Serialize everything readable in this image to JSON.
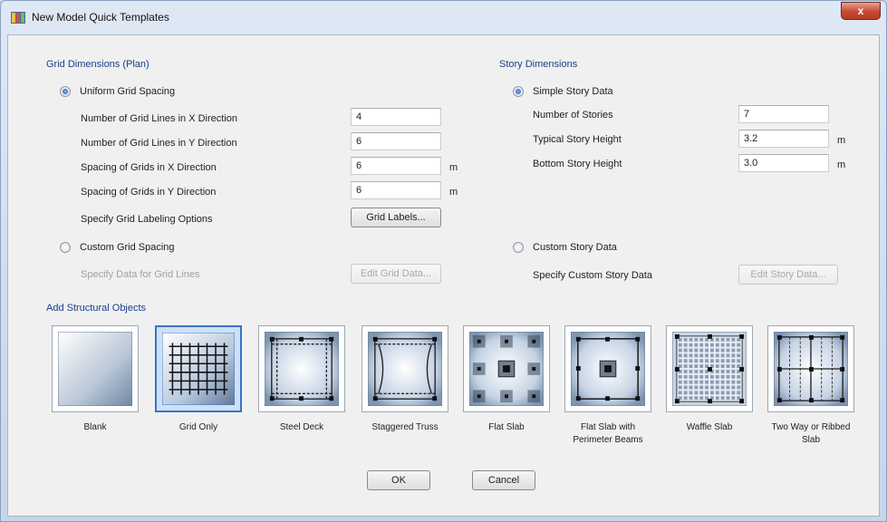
{
  "window": {
    "title": "New Model Quick Templates",
    "close_glyph": "x"
  },
  "grid": {
    "group_title": "Grid Dimensions (Plan)",
    "uniform_label": "Uniform Grid Spacing",
    "uniform_selected": true,
    "fields": [
      {
        "label": "Number of Grid Lines in X Direction",
        "value": "4",
        "unit": ""
      },
      {
        "label": "Number of Grid Lines in Y Direction",
        "value": "6",
        "unit": ""
      },
      {
        "label": "Spacing of Grids in X Direction",
        "value": "6",
        "unit": "m"
      },
      {
        "label": "Spacing of Grids in Y Direction",
        "value": "6",
        "unit": "m"
      }
    ],
    "labeling_label": "Specify Grid Labeling Options",
    "labeling_button": "Grid Labels...",
    "custom_label": "Custom Grid Spacing",
    "custom_data_label": "Specify Data for Grid Lines",
    "custom_button": "Edit Grid Data..."
  },
  "story": {
    "group_title": "Story Dimensions",
    "simple_label": "Simple Story Data",
    "simple_selected": true,
    "fields": [
      {
        "label": "Number of Stories",
        "value": "7",
        "unit": ""
      },
      {
        "label": "Typical Story Height",
        "value": "3.2",
        "unit": "m"
      },
      {
        "label": "Bottom Story Height",
        "value": "3.0",
        "unit": "m"
      }
    ],
    "custom_label": "Custom Story Data",
    "custom_data_label": "Specify Custom Story Data",
    "custom_button": "Edit Story Data..."
  },
  "structural": {
    "group_title": "Add Structural Objects",
    "selected_index": 1,
    "tiles": [
      {
        "label": "Blank",
        "icon": "blank-icon"
      },
      {
        "label": "Grid Only",
        "icon": "grid-only-icon"
      },
      {
        "label": "Steel Deck",
        "icon": "steel-deck-icon"
      },
      {
        "label": "Staggered Truss",
        "icon": "staggered-truss-icon"
      },
      {
        "label": "Flat Slab",
        "icon": "flat-slab-icon"
      },
      {
        "label": "Flat Slab with Perimeter Beams",
        "icon": "flat-slab-perimeter-beams-icon"
      },
      {
        "label": "Waffle Slab",
        "icon": "waffle-slab-icon"
      },
      {
        "label": "Two Way or Ribbed Slab",
        "icon": "two-way-ribbed-slab-icon"
      }
    ]
  },
  "buttons": {
    "ok": "OK",
    "cancel": "Cancel"
  }
}
